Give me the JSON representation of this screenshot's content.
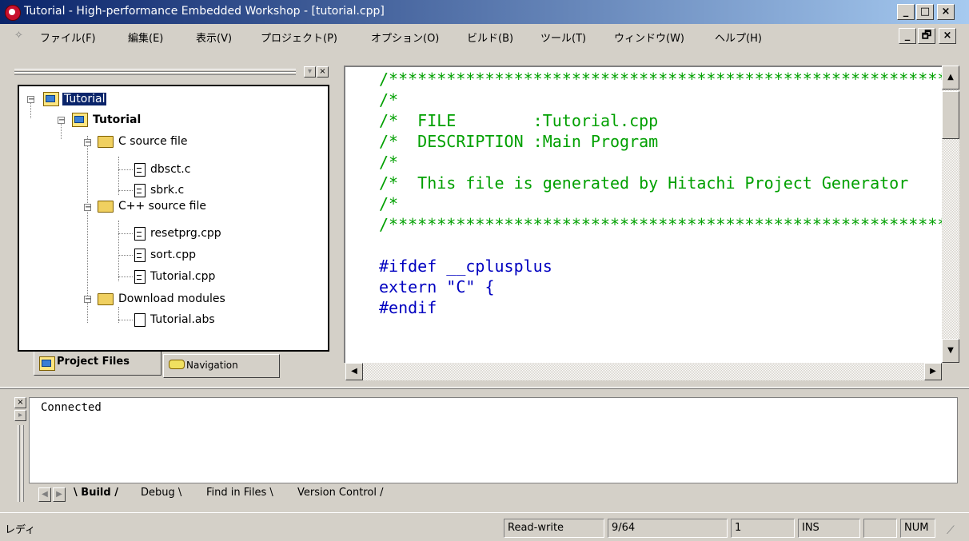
{
  "window": {
    "title": "Tutorial - High-performance Embedded Workshop - [tutorial.cpp]",
    "buttons": {
      "minimize": "_",
      "maximize": "□",
      "close": "×",
      "restore": "🗗"
    }
  },
  "menu": {
    "items": [
      {
        "label": "ファイル(F)"
      },
      {
        "label": "編集(E)"
      },
      {
        "label": "表示(V)"
      },
      {
        "label": "プロジェクト(P)"
      },
      {
        "label": "オプション(O)"
      },
      {
        "label": "ビルド(B)"
      },
      {
        "label": "ツール(T)"
      },
      {
        "label": "ウィンドウ(W)"
      },
      {
        "label": "ヘルプ(H)"
      }
    ]
  },
  "project_tree": {
    "workspace": "Tutorial",
    "project": "Tutorial",
    "folders": [
      {
        "label": "C source file",
        "files": [
          "dbsct.c",
          "sbrk.c"
        ]
      },
      {
        "label": "C++ source file",
        "files": [
          "resetprg.cpp",
          "sort.cpp",
          "Tutorial.cpp"
        ]
      },
      {
        "label": "Download modules",
        "files": [
          "Tutorial.abs"
        ]
      }
    ],
    "expand_symbol": "−"
  },
  "panel_tabs": {
    "project_files": "Project Files",
    "navigation": "Navigation"
  },
  "editor": {
    "lines": [
      "/*************************************************************",
      "/*",
      "/*  FILE        :Tutorial.cpp",
      "/*  DESCRIPTION :Main Program",
      "/*",
      "/*  This file is generated by Hitachi Project Generator",
      "/*",
      "/*************************************************************",
      "",
      "#ifdef __cplusplus",
      "extern \"C\" {",
      "#endif"
    ],
    "comment_color": "#00a000",
    "code_color": "#0000c0"
  },
  "output": {
    "text": "Connected",
    "tabs": [
      "Build",
      "Debug",
      "Find in Files",
      "Version Control"
    ],
    "active_tab": "Build"
  },
  "status": {
    "message": "レディ",
    "mode": "Read-write",
    "line": "9/64",
    "column": "1",
    "insert": "INS",
    "num": "NUM"
  }
}
